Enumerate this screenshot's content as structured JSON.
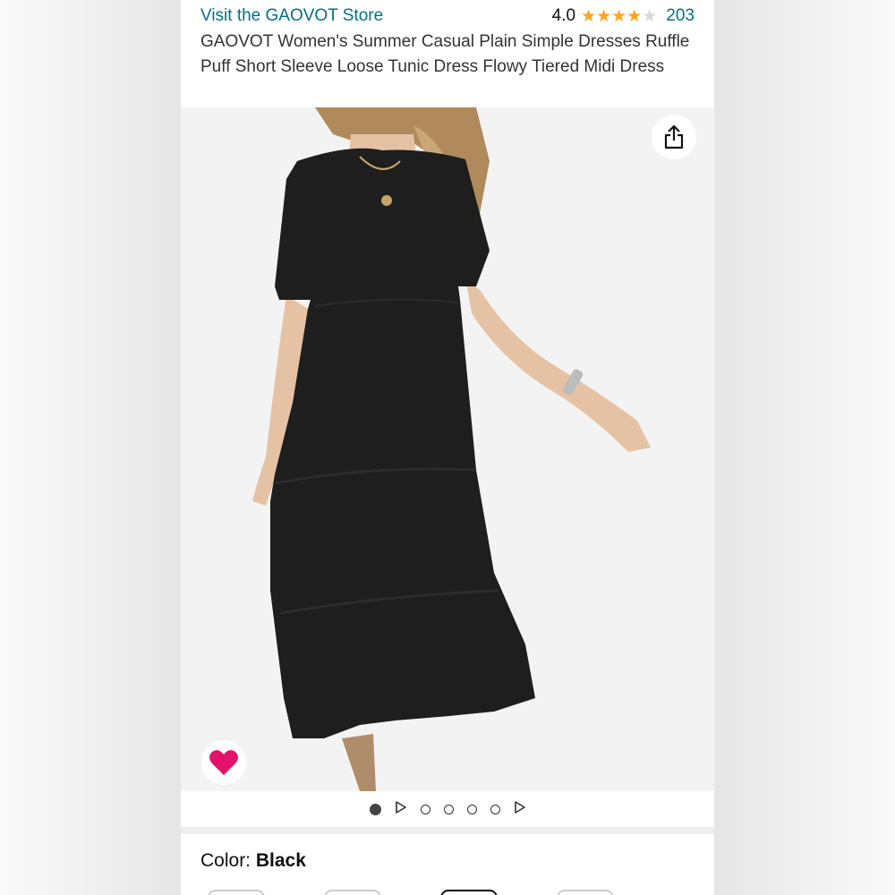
{
  "store": {
    "link_text": "Visit the GAOVOT Store"
  },
  "rating": {
    "value": "4.0",
    "stars": 4,
    "max_stars": 5,
    "review_count": "203"
  },
  "product": {
    "title": "GAOVOT Women's Summer Casual Plain Simple Dresses Ruffle Puff Short Sleeve Loose Tunic Dress Flowy Tiered Midi Dress"
  },
  "image": {
    "subject_color": "#1e1e1e",
    "background_color": "#f3f3f3"
  },
  "icons": {
    "share": "share-icon",
    "favorite": "heart-icon"
  },
  "colors": {
    "link": "#007185",
    "star": "#ffa41c",
    "heart": "#e3136b"
  },
  "carousel": {
    "items": [
      "image",
      "video",
      "image",
      "image",
      "image",
      "image",
      "video"
    ],
    "active_index": 0
  },
  "color_selection": {
    "label": "Color: ",
    "value": "Black"
  }
}
